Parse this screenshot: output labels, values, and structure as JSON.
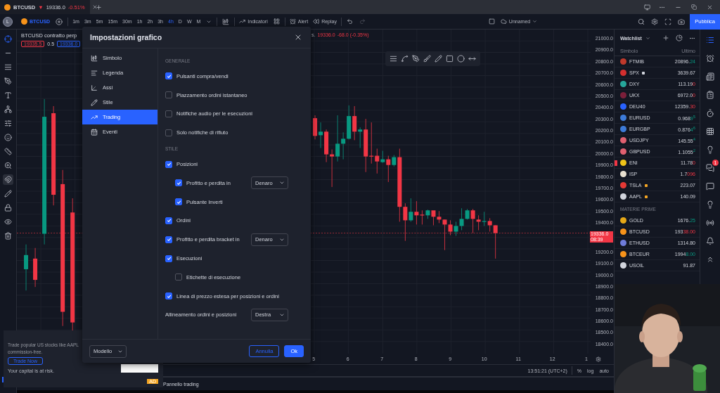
{
  "title_bar": {
    "tab": {
      "symbol": "BTCUSD",
      "arrow": "▼",
      "price": "19336.0",
      "change": "-0.51%"
    }
  },
  "toolbar": {
    "avatar": "L",
    "symbol": "BTCUSD",
    "timeframes": [
      {
        "label": "1m",
        "selected": false
      },
      {
        "label": "3m",
        "selected": false
      },
      {
        "label": "5m",
        "selected": false
      },
      {
        "label": "15m",
        "selected": false
      },
      {
        "label": "30m",
        "selected": false
      },
      {
        "label": "1h",
        "selected": false
      },
      {
        "label": "2h",
        "selected": false
      },
      {
        "label": "3h",
        "selected": false
      },
      {
        "label": "4h",
        "selected": true
      },
      {
        "label": "D",
        "selected": false
      },
      {
        "label": "W",
        "selected": false
      },
      {
        "label": "M",
        "selected": false
      }
    ],
    "indicators": "Indicatori",
    "alert": "Alert",
    "replay": "Replay",
    "layout_name": "Unnamed",
    "publish": "Pubblica"
  },
  "drawing_tools": [
    {
      "selected": true,
      "on": false
    },
    {
      "selected": false,
      "on": false
    },
    {
      "selected": false,
      "on": false
    },
    {
      "selected": false,
      "on": false
    },
    {
      "selected": false,
      "on": false
    },
    {
      "selected": false,
      "on": false
    },
    {
      "selected": false,
      "on": false
    },
    {
      "selected": false,
      "on": false
    },
    {
      "selected": false,
      "on": false
    },
    {
      "selected": false,
      "on": false
    },
    {
      "selected": false,
      "on": true
    },
    {
      "selected": false,
      "on": false
    },
    {
      "selected": false,
      "on": false
    },
    {
      "selected": false,
      "on": false
    },
    {
      "selected": false,
      "on": false
    }
  ],
  "chart": {
    "legend": {
      "title": "BTCUSD contratto perp",
      "bid": "19335.5",
      "spread": "0.5",
      "ask": "19336.0",
      "tail": "s.",
      "last": "19336.0",
      "change": "-68.0 (-0.35%)"
    },
    "price_axis": [
      {
        "label": "21000.0"
      },
      {
        "label": "20900.0"
      },
      {
        "label": "20800.0"
      },
      {
        "label": "20700.0"
      },
      {
        "label": "20600.0"
      },
      {
        "label": "20500.0"
      },
      {
        "label": "20400.0"
      },
      {
        "label": "20300.0"
      },
      {
        "label": "20200.0"
      },
      {
        "label": "20100.0"
      },
      {
        "label": "20000.0"
      },
      {
        "label": "19900.0"
      },
      {
        "label": "19800.0"
      },
      {
        "label": "19700.0"
      },
      {
        "label": "19600.0"
      },
      {
        "label": "19500.0"
      },
      {
        "label": "19400.0"
      },
      {
        "kind": "last_price",
        "label": "19336.0",
        "sub": "08:39"
      },
      {
        "label": "19200.0"
      },
      {
        "label": "19100.0"
      },
      {
        "label": "19000.0"
      },
      {
        "label": "18900.0"
      },
      {
        "label": "18800.0"
      },
      {
        "label": "18700.0"
      },
      {
        "label": "18600.0"
      },
      {
        "label": "18500.0"
      },
      {
        "label": "18400.0"
      }
    ],
    "time_axis": [
      "5",
      "6",
      "7",
      "8",
      "9",
      "10",
      "11",
      "12",
      "1"
    ],
    "clock": "13:51:21 (UTC+2)",
    "scale_buttons": [
      "%",
      "log",
      "auto"
    ]
  },
  "bottom_panel": {
    "tab": "Pannello trading"
  },
  "dialog": {
    "title": "Impostazioni grafico",
    "sidebar": [
      {
        "label": "Simbolo",
        "selected": false
      },
      {
        "label": "Legenda",
        "selected": false
      },
      {
        "label": "Assi",
        "selected": false
      },
      {
        "label": "Stile",
        "selected": false
      },
      {
        "label": "Trading",
        "selected": true
      },
      {
        "label": "Eventi",
        "selected": false
      }
    ],
    "rows": [
      {
        "kind": "section",
        "label": "GENERALE"
      },
      {
        "kind": "checkbox",
        "label": "Pulsanti compra/vendi",
        "checked": true
      },
      {
        "kind": "checkbox",
        "label": "Piazzamento ordini istantaneo",
        "checked": false
      },
      {
        "kind": "checkbox",
        "label": "Notifiche audio per le esecuzioni",
        "checked": false
      },
      {
        "kind": "checkbox",
        "label": "Solo notifiche di rifiuto",
        "checked": false
      },
      {
        "kind": "section",
        "label": "STILE"
      },
      {
        "kind": "checkbox",
        "label": "Posizioni",
        "checked": true,
        "children": [
          {
            "kind": "checkbox",
            "label": "Profitto e perdita in",
            "checked": true,
            "select": "Denaro"
          },
          {
            "kind": "checkbox",
            "label": "Pulsante Inverti",
            "checked": true
          }
        ]
      },
      {
        "kind": "checkbox",
        "label": "Ordini",
        "checked": true
      },
      {
        "kind": "checkbox",
        "label": "Profitto e perdita bracket in",
        "checked": true,
        "select": "Denaro"
      },
      {
        "kind": "checkbox",
        "label": "Esecuzioni",
        "checked": true,
        "children": [
          {
            "kind": "checkbox",
            "label": "Etichette di esecuzione",
            "checked": false
          }
        ]
      },
      {
        "kind": "checkbox",
        "label": "Linea di prezzo estesa per posizioni e ordini",
        "checked": true
      },
      {
        "kind": "select",
        "label": "Allineamento ordini e posizioni",
        "select": "Destra"
      }
    ],
    "template": "Modello",
    "cancel": "Annulla",
    "ok": "Ok"
  },
  "ad": {
    "text": "Trade popular US stocks like AAPL",
    "text2": "commission-free.",
    "button": "Trade Now",
    "note": "Your capital is at risk.",
    "badge": "AD"
  },
  "watchlist": {
    "title": "Watchlist",
    "columns": [
      "Simbolo",
      "Ultimo"
    ],
    "sections": [
      {
        "rows": [
          {
            "symbol": "FTMIB",
            "color": "#c0392b",
            "flagged": false,
            "price": "20896.",
            "tick": {
              "text": "24",
              "up": true
            }
          },
          {
            "symbol": "SPX",
            "color": "#d32f2f",
            "flagged": false,
            "status": {
              "color": "#d1d4dc"
            },
            "price": "3639.67"
          },
          {
            "symbol": "DXY",
            "color": "#26a69a",
            "flagged": false,
            "price": "113.19",
            "tick": {
              "text": "0",
              "up": false
            }
          },
          {
            "symbol": "UKX",
            "color": "#7b1f3a",
            "flagged": false,
            "price": "6972.0",
            "tick": {
              "text": "0",
              "up": false
            }
          },
          {
            "symbol": "DEU40",
            "color": "#2962ff",
            "flagged": false,
            "price": "12359.",
            "tick": {
              "text": "30",
              "up": false
            }
          },
          {
            "symbol": "EURUSD",
            "color": "#3d7bd9",
            "flagged": false,
            "price": "0.968",
            "tick": {
              "text": "9$^{5}$",
              "up": true
            }
          },
          {
            "symbol": "EURGBP",
            "color": "#3d7bd9",
            "flagged": false,
            "price": "0.876",
            "tick": {
              "text": "4$^{6}$",
              "up": true
            }
          },
          {
            "symbol": "USDJPY",
            "color": "#e06070",
            "flagged": false,
            "price": "145.55",
            "tick": {
              "text": "$^{4}$",
              "up": true
            }
          },
          {
            "symbol": "GBPUSD",
            "color": "#e06070",
            "flagged": false,
            "price": "1.1055",
            "tick": {
              "text": "$^{2}$",
              "up": true
            }
          },
          {
            "symbol": "ENI",
            "color": "#f0c419",
            "flagged": true,
            "price": "11.78",
            "tick": {
              "text": "0",
              "up": false
            }
          },
          {
            "symbol": "ISP",
            "color": "#e8e0d0",
            "flagged": false,
            "price": "1.7",
            "tick": {
              "text": "096",
              "up": false
            }
          },
          {
            "symbol": "TSLA",
            "color": "#e53935",
            "flagged": false,
            "status": {
              "color": "#f5a623"
            },
            "price": "223.07"
          },
          {
            "symbol": "AAPL",
            "color": "#d1d4dc",
            "flagged": false,
            "status": {
              "color": "#f5a623"
            },
            "price": "140.09"
          }
        ]
      },
      {
        "title": "MATERIE PRIME",
        "rows": [
          {
            "symbol": "GOLD",
            "color": "#e6a817",
            "flagged": false,
            "price": "1676.",
            "tick": {
              "text": "25",
              "up": true
            }
          },
          {
            "symbol": "BTCUSD",
            "color": "#f7931a",
            "flagged": false,
            "price": "193",
            "tick": {
              "text": "38.00",
              "up": false
            }
          },
          {
            "symbol": "ETHUSD",
            "color": "#6f7cda",
            "flagged": false,
            "price": "1314.80"
          },
          {
            "symbol": "BTCEUR",
            "color": "#f7931a",
            "flagged": false,
            "price": "1994",
            "tick": {
              "text": "8.00",
              "up": true
            }
          },
          {
            "symbol": "USOIL",
            "color": "#d1d4dc",
            "flagged": false,
            "price": "91.87"
          }
        ]
      }
    ]
  },
  "side_panel": [
    {
      "selected": true
    },
    {
      "selected": false
    },
    {
      "selected": false
    },
    {
      "selected": false
    },
    {
      "selected": false
    },
    {
      "selected": false
    },
    {
      "selected": false
    },
    {
      "selected": false,
      "badge": "1"
    },
    {
      "selected": false
    },
    {
      "selected": false
    },
    {
      "selected": false
    },
    {
      "selected": false
    },
    {
      "selected": false
    }
  ]
}
